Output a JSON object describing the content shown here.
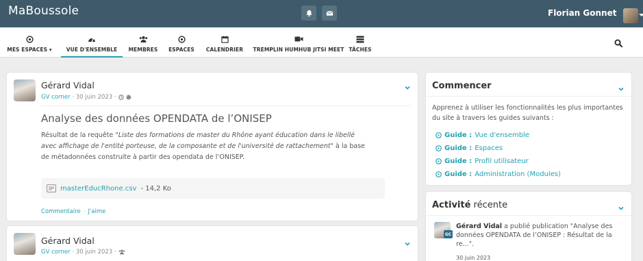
{
  "app": {
    "brand": "MaBoussole",
    "user_name": "Florian Gonnet"
  },
  "nav": {
    "items": [
      {
        "label": "MES ESPACES ▾",
        "icon": "dot-circle-icon"
      },
      {
        "label": "VUE D'ENSEMBLE",
        "icon": "tachometer-icon"
      },
      {
        "label": "MEMBRES",
        "icon": "users-icon"
      },
      {
        "label": "ESPACES",
        "icon": "dot-circle-icon"
      },
      {
        "label": "CALENDRIER",
        "icon": "calendar-icon"
      },
      {
        "label": "TREMPLIN HUMHUB JITSI MEET",
        "icon": "video-camera-icon"
      },
      {
        "label": "TÂCHES",
        "icon": "tasks-icon"
      }
    ],
    "active_index": 1
  },
  "post1": {
    "author": "Gérard Vidal",
    "space": "GV corner",
    "date": " · 30 juin 2023 ·",
    "title": "Analyse des données OPENDATA de l’ONISEP",
    "body_prefix": "Résultat de la requête \"",
    "body_italic": "Liste des formations de master du Rhône ayant éducation dans le libellé avec affichage de l'entité porteuse, de la composante et de l'université de rattachement",
    "body_suffix": "\" à la base de métadonnées construite à partir des opendata de l’ONISEP.",
    "file_name": "masterEducRhone.csv",
    "file_size": " - 14,2 Ko",
    "comment_label": "Commentaire",
    "like_label": "J'aime",
    "action_sep": "·"
  },
  "post2": {
    "author": "Gérard Vidal",
    "space": "GV corner",
    "date": " · 30 juin 2023 ·"
  },
  "getting_started": {
    "title": "Commencer",
    "description": "Apprenez à utiliser les fonctionnalités les plus importantes du site à travers les guides suivants :",
    "guides": [
      {
        "prefix": "Guide :",
        "label": "Vue d'ensemble"
      },
      {
        "prefix": "Guide :",
        "label": "Espaces"
      },
      {
        "prefix": "Guide :",
        "label": "Profil utilisateur"
      },
      {
        "prefix": "Guide :",
        "label": "Administration (Modules)"
      }
    ]
  },
  "activity": {
    "title_bold": "Activité",
    "title_rest": " récente",
    "item": {
      "badge": "GC",
      "author": "Gérard Vidal",
      "text": " a publié publication \"Analyse des données OPENDATA de l’ONISEP : Résultat de la re...\".",
      "date": "30 juin 2023"
    }
  },
  "colors": {
    "topbar": "#3f5b6b",
    "accent": "#21a1b3",
    "background": "#ededed"
  }
}
